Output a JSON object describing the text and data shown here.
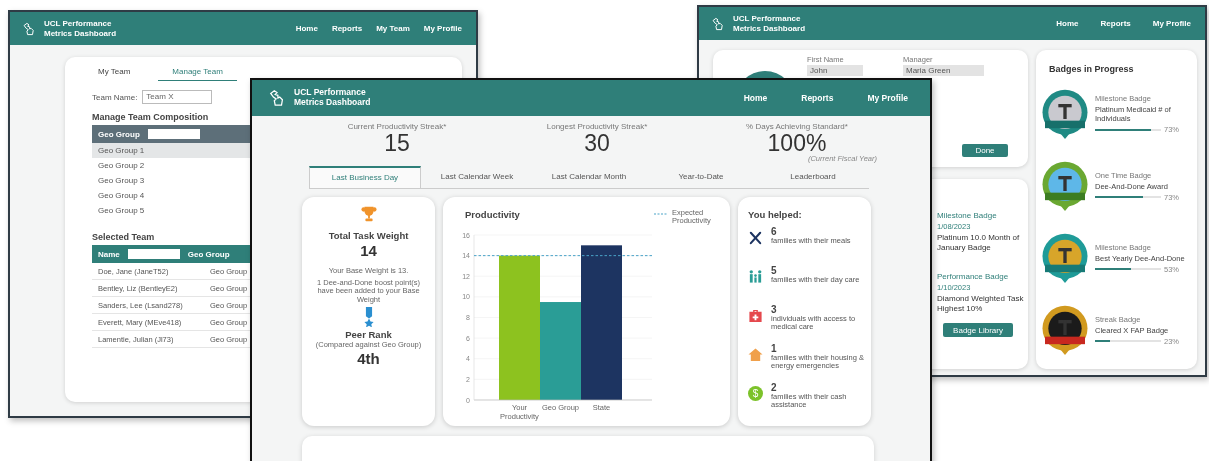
{
  "back_left_window": {
    "header": {
      "title": "UCL Performance Metrics Dashboard",
      "nav": [
        {
          "label": "Home"
        },
        {
          "label": "Reports"
        },
        {
          "label": "My Team"
        },
        {
          "label": "My Profile"
        }
      ]
    },
    "tabs": [
      {
        "label": "My Team",
        "selected": false
      },
      {
        "label": "Manage Team",
        "selected": true
      }
    ],
    "team_name": {
      "label": "Team Name:",
      "value": "Team X"
    },
    "composition": {
      "title": "Manage Team Composition",
      "filter_label": "Geo Group",
      "rows": [
        {
          "label": "Geo Group 1",
          "selected": true
        },
        {
          "label": "Geo Group 2",
          "selected": false
        },
        {
          "label": "Geo Group 3",
          "selected": false
        },
        {
          "label": "Geo Group 4",
          "selected": false
        },
        {
          "label": "Geo Group 5",
          "selected": false
        }
      ]
    },
    "selected_team": {
      "title": "Selected Team",
      "columns": [
        "Name",
        "Geo Group"
      ],
      "rows": [
        {
          "name": "Doe, Jane (JaneT52)",
          "geo_group": "Geo Group"
        },
        {
          "name": "Bentley, Liz (BentleyE2)",
          "geo_group": "Geo Group"
        },
        {
          "name": "Sanders, Lee (Lsand278)",
          "geo_group": "Geo Group"
        },
        {
          "name": "Everett, Mary (MEve418)",
          "geo_group": "Geo Group"
        },
        {
          "name": "Lamentie, Julian (Jl73)",
          "geo_group": "Geo Group"
        }
      ]
    }
  },
  "back_right_window": {
    "header": {
      "title": "UCL Performance Metrics Dashboard",
      "nav": [
        {
          "label": "Home"
        },
        {
          "label": "Reports"
        },
        {
          "label": "My Profile"
        }
      ]
    },
    "profile": {
      "fields": [
        {
          "label": "First Name",
          "value": "John"
        },
        {
          "label": "Manager",
          "value": "Maria Green"
        }
      ],
      "button": "Done"
    },
    "earned_badges": {
      "items": [
        {
          "type": "Milestone Badge",
          "date": "1/08/2023",
          "name": "Platinum 10.0 Month of January Badge"
        },
        {
          "type": "Performance Badge",
          "date": "1/10/2023",
          "name": "Diamond Weighted Task Highest 10%"
        }
      ],
      "button": "Badge Library"
    },
    "badges_in_progress": {
      "title": "Badges in Progress",
      "items": [
        {
          "type": "Milestone Badge",
          "name": "Platinum Medicaid # of Individuals",
          "level": 0.85,
          "percent": "73%"
        },
        {
          "type": "One Time Badge",
          "name": "Dee-And-Done Award",
          "level": 0.72,
          "percent": "73%"
        },
        {
          "type": "Milestone Badge",
          "name": "Best Yearly Dee-And-Done",
          "level": 0.55,
          "percent": "53%"
        },
        {
          "type": "Streak Badge",
          "name": "Cleared X FAP Badge",
          "level": 0.22,
          "percent": "23%"
        }
      ]
    }
  },
  "front_window": {
    "header": {
      "title": "UCL Performance Metrics Dashboard",
      "nav": [
        {
          "label": "Home"
        },
        {
          "label": "Reports"
        },
        {
          "label": "My Profile"
        }
      ]
    },
    "stats": [
      {
        "label": "Current Productivity Streak*",
        "value": "15"
      },
      {
        "label": "Longest Productivity Streak*",
        "value": "30"
      },
      {
        "label": "% Days Achieving Standard*",
        "value": "100%",
        "note": "(Current Fiscal Year)"
      }
    ],
    "tabs": [
      {
        "label": "Last Business Day",
        "selected": true
      },
      {
        "label": "Last Calendar Week",
        "selected": false
      },
      {
        "label": "Last Calendar Month",
        "selected": false
      },
      {
        "label": "Year-to-Date",
        "selected": false
      },
      {
        "label": "Leaderboard",
        "selected": false
      }
    ],
    "task_card": {
      "title": "Total Task Weight",
      "value": "14",
      "base_note": "Your Base Weight is 13.",
      "boost_note": "1 Dee-and-Done boost point(s) have been added to your Base Weight",
      "rank_title": "Peer Rank",
      "rank_note": "(Compared against Geo Group)",
      "rank": "4th"
    },
    "productivity_card": {
      "chart_data": {
        "type": "bar",
        "title": "Productivity",
        "categories": [
          "Your Productivity",
          "Geo Group",
          "State"
        ],
        "values": [
          14,
          9.5,
          15
        ],
        "colors": [
          "#8dc21f",
          "#2a9d96",
          "#1d3461"
        ],
        "ylim": [
          0,
          16
        ],
        "yticks": [
          {
            "value": 0,
            "label": "0"
          },
          {
            "value": 2,
            "label": "2"
          },
          {
            "value": 4,
            "label": "4"
          },
          {
            "value": 6,
            "label": "6"
          },
          {
            "value": 8,
            "label": "8"
          },
          {
            "value": 10,
            "label": "10"
          },
          {
            "value": 12,
            "label": "12"
          },
          {
            "value": 14,
            "label": "14"
          },
          {
            "value": 16,
            "label": "16"
          }
        ],
        "grid": true,
        "ref_lines": [
          {
            "axis": "y",
            "value": 14,
            "label": "Expected Productivity",
            "color": "#4aa3c8"
          }
        ]
      }
    },
    "helped_card": {
      "title": "You helped:",
      "items": [
        {
          "count": "6",
          "text": "families with their meals",
          "color": "#1d3461"
        },
        {
          "count": "5",
          "text": "families with their day care",
          "color": "#2a9d96"
        },
        {
          "count": "3",
          "text": "individuals with access to medical care",
          "color": "#e5484d"
        },
        {
          "count": "1",
          "text": "families with their housing & energy emergencies",
          "color": "#f0a04b"
        },
        {
          "count": "2",
          "text": "families with their cash assistance",
          "color": "#7cc22a",
          "symbol": "$"
        }
      ]
    }
  }
}
